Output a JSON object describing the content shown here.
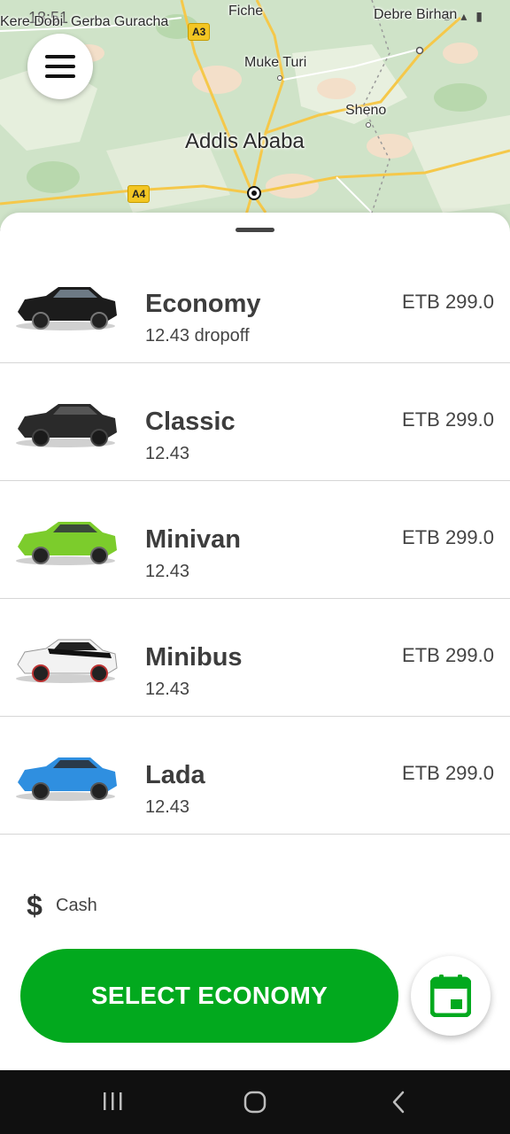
{
  "status_bar": {
    "time": "18:51",
    "icons": "✆ ▴ ▮"
  },
  "map": {
    "labels": {
      "kere_dobi": "Kere Dobi",
      "gerba_guracha": "Gerba Guracha",
      "fiche": "Fiche",
      "debre_birhan": "Debre Birhan",
      "muke_turi": "Muke Turi",
      "sheno": "Sheno",
      "addis_ababa": "Addis Ababa"
    },
    "road_shields": {
      "a3": "A3",
      "a4": "A4"
    }
  },
  "menu_button": {
    "icon": "hamburger-menu-icon"
  },
  "rides": [
    {
      "name": "Economy",
      "sub": "12.43 dropoff",
      "price": "ETB 299.0",
      "car_color": "#1c1c1c"
    },
    {
      "name": "Classic",
      "sub": "12.43",
      "price": "ETB 299.0",
      "car_color": "#2a2a2a"
    },
    {
      "name": "Minivan",
      "sub": "12.43",
      "price": "ETB 299.0",
      "car_color": "#7ccc2c"
    },
    {
      "name": "Minibus",
      "sub": "12.43",
      "price": "ETB 299.0",
      "car_color": "#f2f2f2"
    },
    {
      "name": "Lada",
      "sub": "12.43",
      "price": "ETB 299.0",
      "car_color": "#2f8fe0"
    }
  ],
  "payment": {
    "icon_glyph": "$",
    "label": "Cash"
  },
  "select_button": {
    "label": "SELECT ECONOMY"
  },
  "schedule_button": {
    "icon": "calendar-icon"
  },
  "colors": {
    "accent_green": "#02a91e",
    "nav_bar": "#101010"
  }
}
